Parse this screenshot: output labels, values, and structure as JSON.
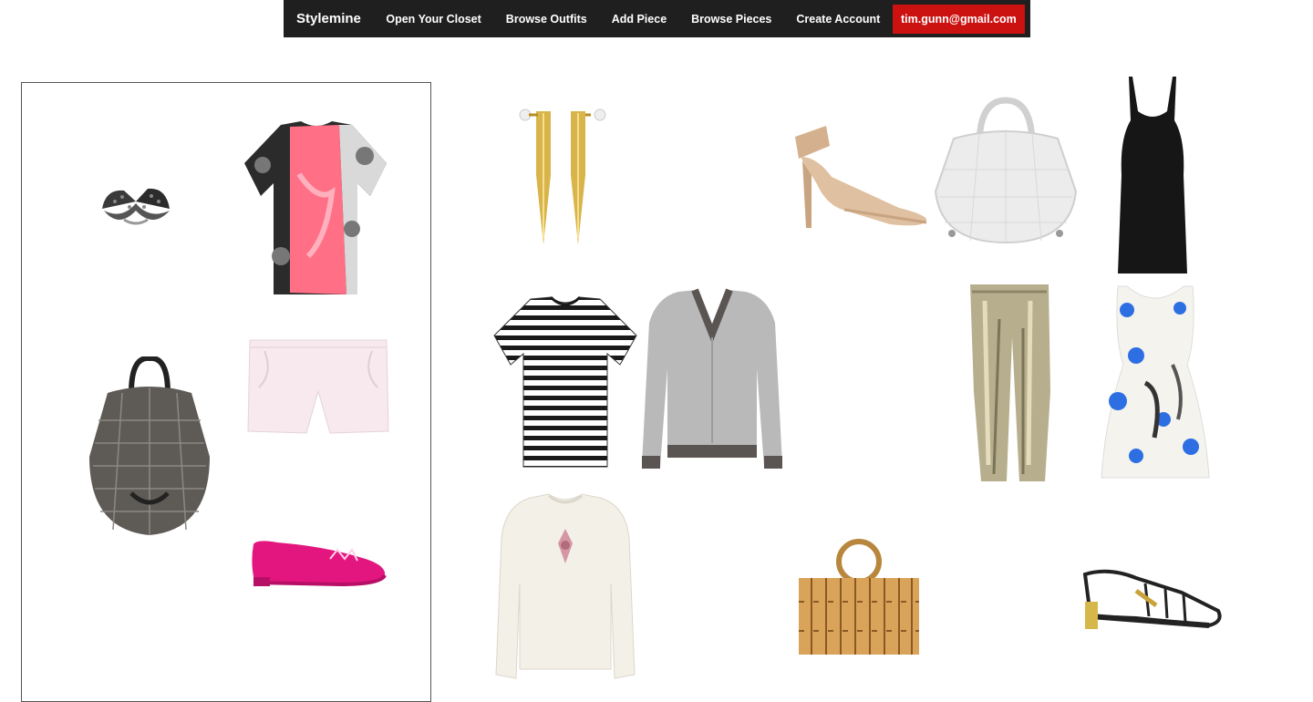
{
  "nav": {
    "brand": "Stylemine",
    "links": [
      "Open Your Closet",
      "Browse Outfits",
      "Add Piece",
      "Browse Pieces",
      "Create Account"
    ],
    "user": "tim.gunn@gmail.com"
  },
  "colors": {
    "nav_bg": "#1f1f1f",
    "accent": "#cc1111"
  },
  "closet_items": [
    {
      "name": "bow-ring-icon"
    },
    {
      "name": "pink-print-tshirt-icon"
    },
    {
      "name": "snakeskin-backpack-icon"
    },
    {
      "name": "white-shorts-icon"
    },
    {
      "name": "pink-flat-shoe-icon"
    }
  ],
  "catalog_items": [
    {
      "name": "gold-spike-earrings-icon"
    },
    {
      "name": "nude-heel-sandal-icon"
    },
    {
      "name": "white-handbag-icon"
    },
    {
      "name": "black-dress-icon"
    },
    {
      "name": "striped-tshirt-icon"
    },
    {
      "name": "grey-sweater-icon"
    },
    {
      "name": "metallic-pants-icon"
    },
    {
      "name": "floral-dress-icon"
    },
    {
      "name": "cream-sweater-icon"
    },
    {
      "name": "bamboo-clutch-icon"
    },
    {
      "name": "strappy-sandal-icon"
    }
  ]
}
